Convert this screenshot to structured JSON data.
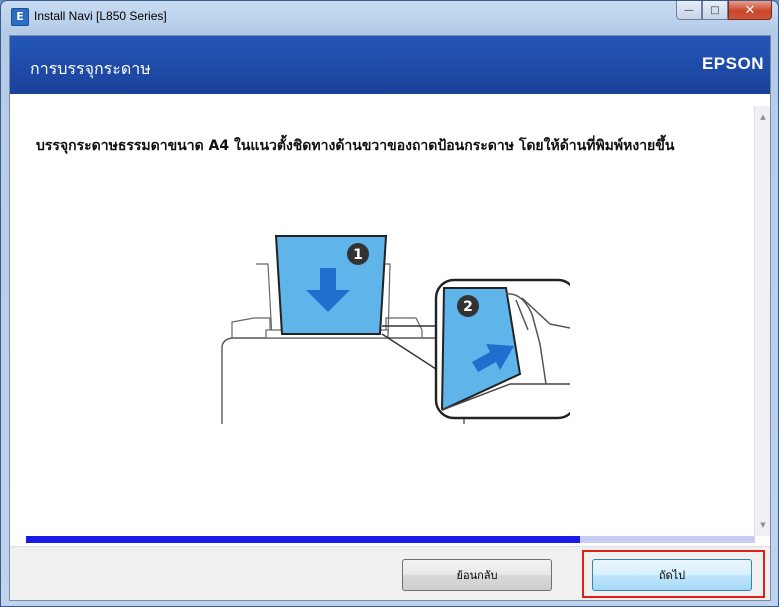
{
  "window": {
    "title": "Install Navi [L850 Series]",
    "app_icon": "E"
  },
  "caption": {
    "minimize_glyph": "—",
    "maximize_glyph": "□",
    "close_glyph": "✕"
  },
  "header": {
    "title": "การบรรจุกระดาษ",
    "brand": "EPSON"
  },
  "content": {
    "instruction": "บรรจุกระดาษธรรมดาขนาด A4 ในแนวตั้งชิดทางด้านขวาของถาดป้อนกระดาษ โดยให้ด้านที่พิมพ์หงายขึ้น",
    "step_labels": [
      "1",
      "2"
    ]
  },
  "progress": {
    "value": 0.76
  },
  "footer": {
    "back_label": "ย้อนกลับ",
    "next_label": "ถัดไป"
  },
  "colors": {
    "header": "#1e4aa6",
    "progress_fill": "#1a1ae6",
    "progress_track": "#c8cbf3",
    "arrow": "#1f6fcf",
    "highlight": "#e0201a"
  }
}
